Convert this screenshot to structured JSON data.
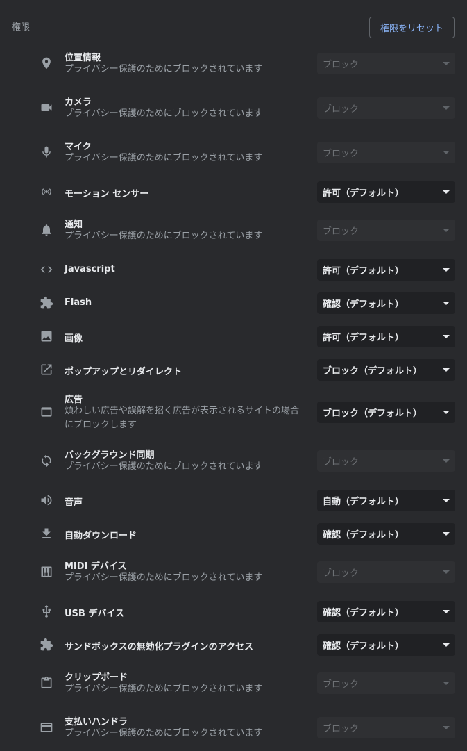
{
  "header": {
    "title": "権限",
    "reset_label": "権限をリセット"
  },
  "rows": [
    {
      "icon": "location-icon",
      "label": "位置情報",
      "sub": "プライバシー保護のためにブロックされています",
      "value": "ブロック",
      "disabled": true
    },
    {
      "icon": "camera-icon",
      "label": "カメラ",
      "sub": "プライバシー保護のためにブロックされています",
      "value": "ブロック",
      "disabled": true
    },
    {
      "icon": "microphone-icon",
      "label": "マイク",
      "sub": "プライバシー保護のためにブロックされています",
      "value": "ブロック",
      "disabled": true
    },
    {
      "icon": "motion-sensor-icon",
      "label": "モーション センサー",
      "sub": "",
      "value": "許可（デフォルト）",
      "disabled": false
    },
    {
      "icon": "bell-icon",
      "label": "通知",
      "sub": "プライバシー保護のためにブロックされています",
      "value": "ブロック",
      "disabled": true
    },
    {
      "icon": "code-icon",
      "label": "Javascript",
      "sub": "",
      "value": "許可（デフォルト）",
      "disabled": false
    },
    {
      "icon": "puzzle-icon",
      "label": "Flash",
      "sub": "",
      "value": "確認（デフォルト）",
      "disabled": false
    },
    {
      "icon": "image-icon",
      "label": "画像",
      "sub": "",
      "value": "許可（デフォルト）",
      "disabled": false
    },
    {
      "icon": "open-in-new-icon",
      "label": "ポップアップとリダイレクト",
      "sub": "",
      "value": "ブロック（デフォルト）",
      "disabled": false
    },
    {
      "icon": "ad-window-icon",
      "label": "広告",
      "sub": "煩わしい広告や誤解を招く広告が表示されるサイトの場合にブロックします",
      "value": "ブロック（デフォルト）",
      "disabled": false
    },
    {
      "icon": "sync-icon",
      "label": "バックグラウンド同期",
      "sub": "プライバシー保護のためにブロックされています",
      "value": "ブロック",
      "disabled": true
    },
    {
      "icon": "volume-icon",
      "label": "音声",
      "sub": "",
      "value": "自動（デフォルト）",
      "disabled": false
    },
    {
      "icon": "download-icon",
      "label": "自動ダウンロード",
      "sub": "",
      "value": "確認（デフォルト）",
      "disabled": false
    },
    {
      "icon": "piano-icon",
      "label": "MIDI デバイス",
      "sub": "プライバシー保護のためにブロックされています",
      "value": "ブロック",
      "disabled": true
    },
    {
      "icon": "usb-icon",
      "label": "USB デバイス",
      "sub": "",
      "value": "確認（デフォルト）",
      "disabled": false
    },
    {
      "icon": "puzzle-icon",
      "label": "サンドボックスの無効化プラグインのアクセス",
      "sub": "",
      "value": "確認（デフォルト）",
      "disabled": false
    },
    {
      "icon": "clipboard-icon",
      "label": "クリップボード",
      "sub": "プライバシー保護のためにブロックされています",
      "value": "ブロック",
      "disabled": true
    },
    {
      "icon": "credit-card-icon",
      "label": "支払いハンドラ",
      "sub": "プライバシー保護のためにブロックされています",
      "value": "ブロック",
      "disabled": true
    }
  ]
}
